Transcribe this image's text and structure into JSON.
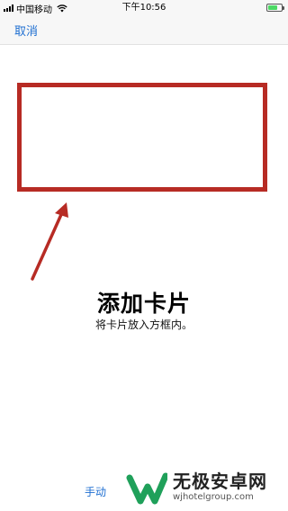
{
  "status_bar": {
    "carrier": "中国移动",
    "time": "下午10:56",
    "battery_level": 0.7,
    "battery_color": "#4cd964"
  },
  "nav": {
    "cancel_label": "取消"
  },
  "main": {
    "title": "添加卡片",
    "subtitle": "将卡片放入方框内。",
    "frame_color": "#b72b24",
    "arrow_color": "#b72b24"
  },
  "footer": {
    "manual_label": "手动"
  },
  "watermark": {
    "title": "无极安卓网",
    "url": "wjhotelgroup.com",
    "brand_color": "#1fa05a"
  },
  "colors": {
    "accent": "#1f6fd1"
  }
}
